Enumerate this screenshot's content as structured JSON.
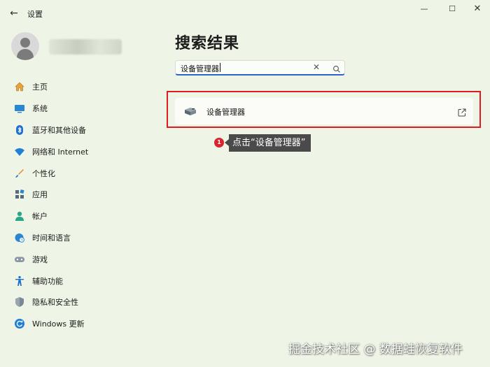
{
  "app": {
    "title": "设置"
  },
  "window_controls": {
    "minimize": "—",
    "maximize": "☐",
    "close": "✕"
  },
  "page": {
    "title": "搜索结果"
  },
  "search": {
    "value": "设备管理器",
    "clear_glyph": "✕"
  },
  "result": {
    "label": "设备管理器"
  },
  "nav": {
    "items": [
      {
        "label": "主页",
        "icon": "home-icon"
      },
      {
        "label": "系统",
        "icon": "monitor-icon"
      },
      {
        "label": "蓝牙和其他设备",
        "icon": "bluetooth-icon"
      },
      {
        "label": "网络和 Internet",
        "icon": "wifi-icon"
      },
      {
        "label": "个性化",
        "icon": "brush-icon"
      },
      {
        "label": "应用",
        "icon": "apps-icon"
      },
      {
        "label": "帐户",
        "icon": "account-icon"
      },
      {
        "label": "时间和语言",
        "icon": "globe-clock-icon"
      },
      {
        "label": "游戏",
        "icon": "gamepad-icon"
      },
      {
        "label": "辅助功能",
        "icon": "accessibility-icon"
      },
      {
        "label": "隐私和安全性",
        "icon": "shield-icon"
      },
      {
        "label": "Windows 更新",
        "icon": "update-icon"
      }
    ]
  },
  "annotation": {
    "step": "1",
    "text": "点击“设备管理器”"
  },
  "watermark": {
    "text": "掘金技术社区 @ 数据蛙恢复软件"
  },
  "colors": {
    "background": "#eef5e6",
    "accent": "#2b63c6",
    "highlight": "#e11b22"
  }
}
